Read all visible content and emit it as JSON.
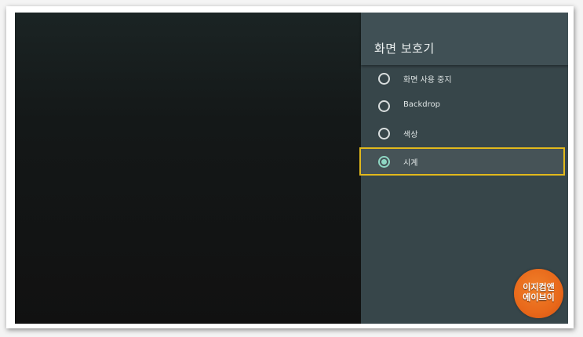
{
  "panel": {
    "title": "화면 보호기",
    "options": [
      {
        "label": "화면 사용 중지",
        "checked": false
      },
      {
        "label": "Backdrop",
        "checked": false
      },
      {
        "label": "색상",
        "checked": false
      },
      {
        "label": "시계",
        "checked": true
      }
    ]
  },
  "watermark": {
    "line1": "이지컴앤",
    "line2": "에이브이"
  },
  "colors": {
    "accent": "#8fd7c4",
    "focus_border": "#e2b91c",
    "panel_bg": "#37464a"
  }
}
